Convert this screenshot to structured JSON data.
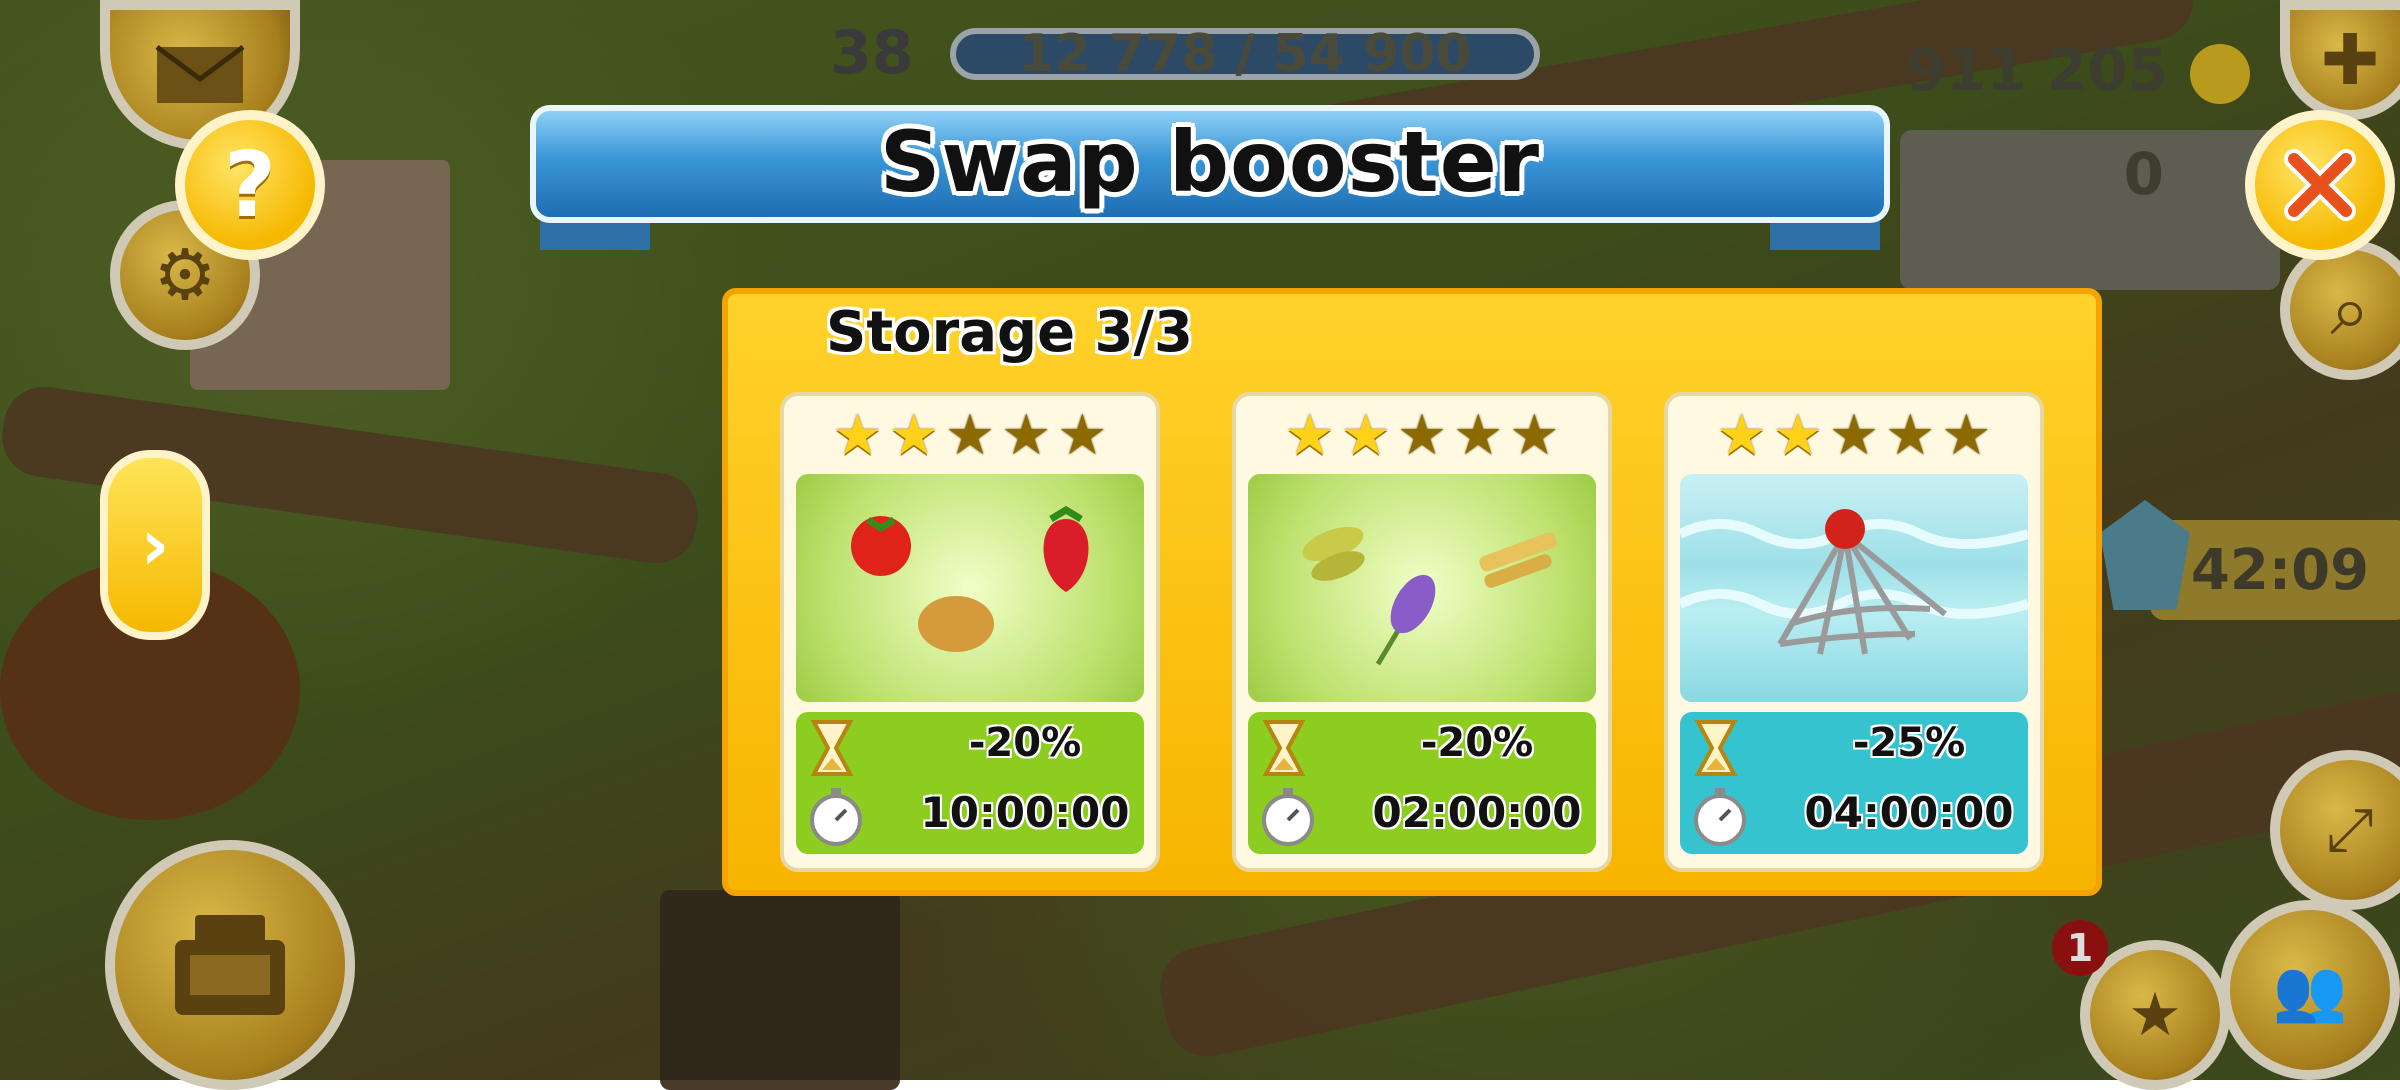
{
  "hud": {
    "level": "38",
    "xp": "12 778 / 54 900",
    "coins": "911 205",
    "diamonds": "0",
    "side_timer": "42:09",
    "side_timer_icon": "percent-badge-icon",
    "notification_count": "1"
  },
  "dialog": {
    "title": "Swap booster",
    "storage_label": "Storage 3/3",
    "colors": {
      "banner": "#3a95d6",
      "panel": "#ffd22b",
      "green_card": "#8ccd1f",
      "blue_card": "#35c4cf"
    },
    "boosters": [
      {
        "stars_filled": 2,
        "stars_total": 5,
        "theme": "green",
        "items": [
          "tomato-icon",
          "strawberry-icon",
          "potato-icon"
        ],
        "discount": "-20%",
        "duration": "10:00:00"
      },
      {
        "stars_filled": 2,
        "stars_total": 5,
        "theme": "green",
        "items": [
          "soybean-icon",
          "sugarcane-icon",
          "lavender-icon"
        ],
        "discount": "-20%",
        "duration": "02:00:00"
      },
      {
        "stars_filled": 2,
        "stars_total": 5,
        "theme": "blue",
        "items": [
          "fishing-net-icon"
        ],
        "discount": "-25%",
        "duration": "04:00:00"
      }
    ]
  }
}
